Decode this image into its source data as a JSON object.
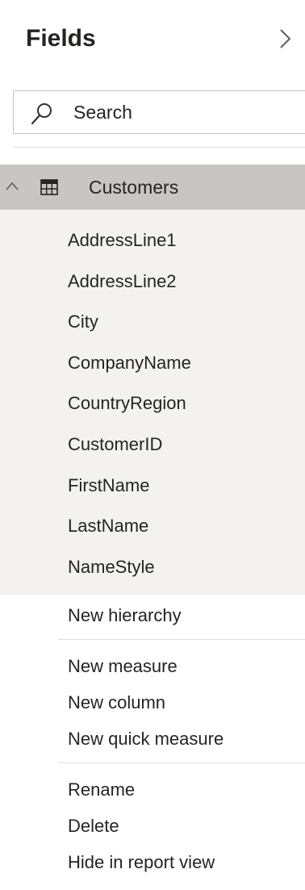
{
  "pane": {
    "title": "Fields",
    "expand_icon": "chevron-right-icon"
  },
  "search": {
    "placeholder": "Search",
    "value": "",
    "icon": "search-icon"
  },
  "table": {
    "name": "Customers",
    "expanded": true,
    "collapse_icon": "chevron-up-icon",
    "type_icon": "table-icon",
    "fields": [
      "AddressLine1",
      "AddressLine2",
      "City",
      "CompanyName",
      "CountryRegion",
      "CustomerID",
      "FirstName",
      "LastName",
      "NameStyle"
    ]
  },
  "context_menu": {
    "groups": [
      [
        "New hierarchy"
      ],
      [
        "New measure",
        "New column",
        "New quick measure"
      ],
      [
        "Rename",
        "Delete",
        "Hide in report view"
      ]
    ]
  },
  "colors": {
    "header_bg": "#c8c6c4",
    "fields_bg": "#f3f2f1",
    "menu_bg": "#ffffff",
    "text": "#252423",
    "divider": "#e1dfdd"
  }
}
